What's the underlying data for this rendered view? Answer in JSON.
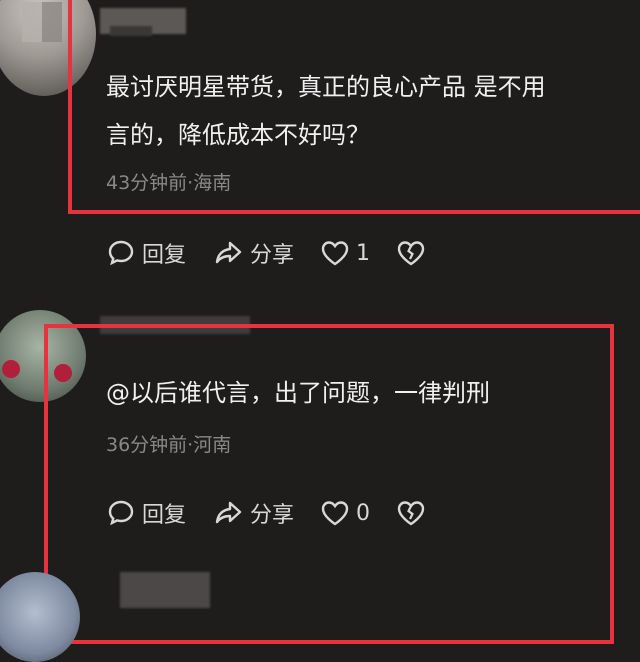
{
  "comments": [
    {
      "text_line1": "最讨厌明星带货，真正的良心产品 是不用",
      "text_line2": "言的，降低成本不好吗？",
      "meta": "43分钟前·海南",
      "actions": {
        "reply": "回复",
        "share": "分享",
        "likes": "1"
      }
    },
    {
      "text": "@以后谁代言，出了问题，一律判刑",
      "meta": "36分钟前·河南",
      "actions": {
        "reply": "回复",
        "share": "分享",
        "likes": "0"
      }
    }
  ],
  "highlight_color": "#e8323c",
  "icons": [
    "reply-icon",
    "share-icon",
    "like-icon",
    "dislike-icon"
  ]
}
